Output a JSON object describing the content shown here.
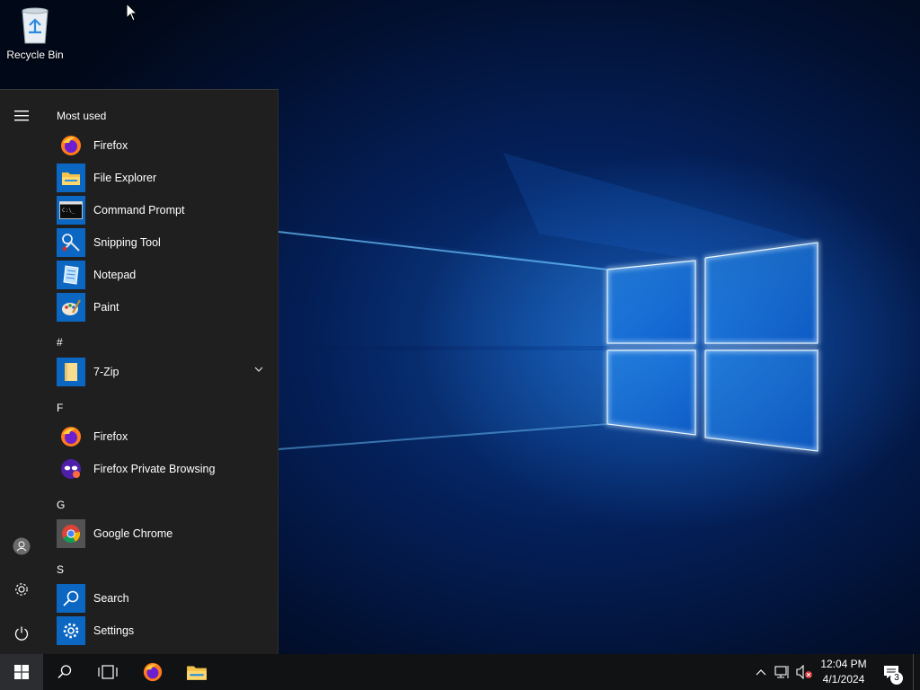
{
  "desktop": {
    "icons": [
      {
        "label": "Recycle Bin",
        "icon": "recycle-bin-icon"
      }
    ]
  },
  "start_menu": {
    "sections": {
      "most_used": "Most used",
      "hash": "#",
      "f": "F",
      "g": "G",
      "s": "S"
    },
    "most_used": [
      {
        "label": "Firefox",
        "icon": "firefox-icon"
      },
      {
        "label": "File Explorer",
        "icon": "file-explorer-icon"
      },
      {
        "label": "Command Prompt",
        "icon": "command-prompt-icon"
      },
      {
        "label": "Snipping Tool",
        "icon": "snipping-tool-icon"
      },
      {
        "label": "Notepad",
        "icon": "notepad-icon"
      },
      {
        "label": "Paint",
        "icon": "paint-icon"
      }
    ],
    "hash_apps": [
      {
        "label": "7-Zip",
        "icon": "folder-icon"
      }
    ],
    "f_apps": [
      {
        "label": "Firefox",
        "icon": "firefox-icon"
      },
      {
        "label": "Firefox Private Browsing",
        "icon": "firefox-private-icon"
      }
    ],
    "g_apps": [
      {
        "label": "Google Chrome",
        "icon": "chrome-icon"
      }
    ],
    "s_apps": [
      {
        "label": "Search",
        "icon": "search-icon"
      },
      {
        "label": "Settings",
        "icon": "gear-icon"
      }
    ],
    "rail": [
      "hamburger-menu-icon",
      "user-icon",
      "settings-icon",
      "power-icon"
    ]
  },
  "taskbar": {
    "time": "12:04 PM",
    "date": "4/1/2024",
    "notification_count": "3",
    "colors": {
      "start_bg": "#2b2d30",
      "taskbar_bg": "#101214",
      "tile_blue": "#0b67c2"
    }
  }
}
